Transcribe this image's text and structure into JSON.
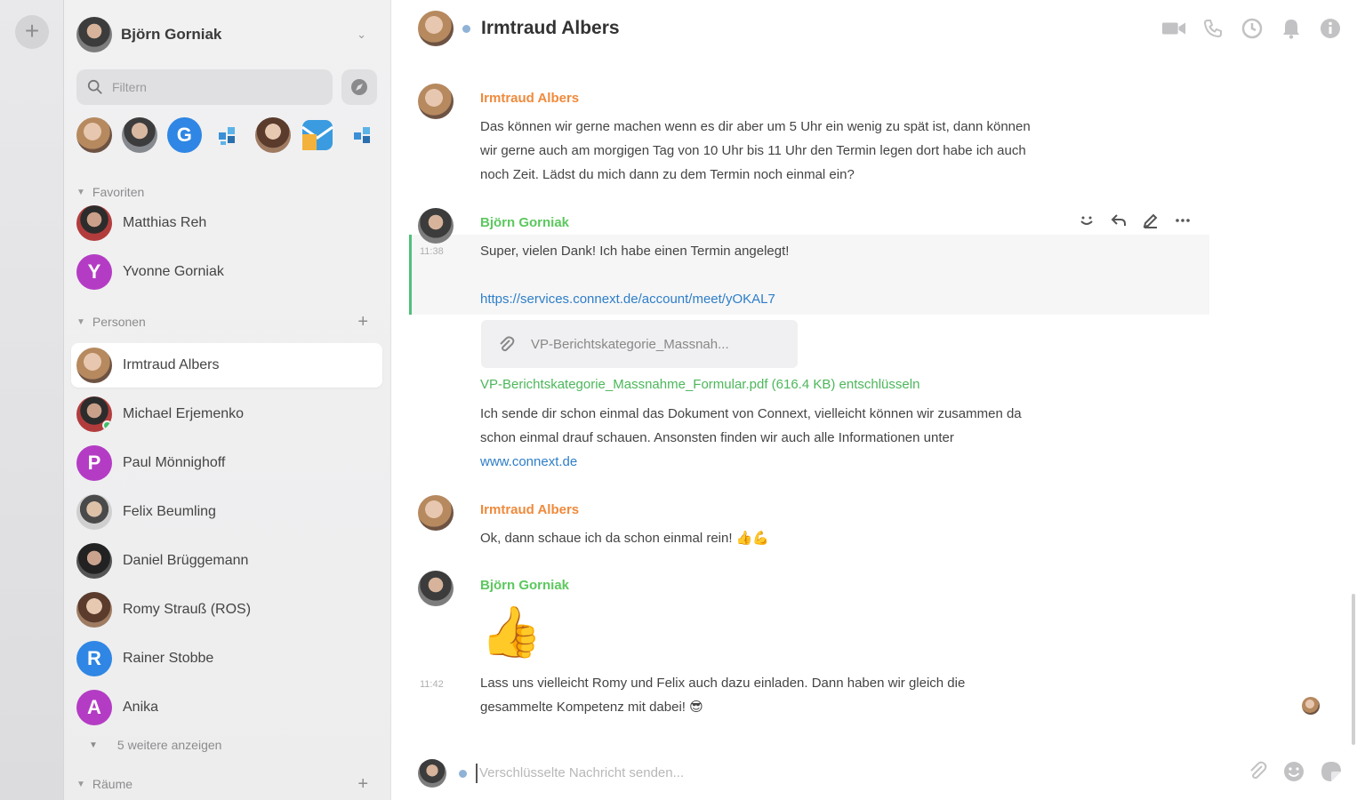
{
  "rail": {
    "add_label": "+"
  },
  "account": {
    "name": "Björn Gorniak"
  },
  "filter": {
    "placeholder": "Filtern"
  },
  "quick_contacts": [
    {
      "type": "photo"
    },
    {
      "type": "photo"
    },
    {
      "type": "letter",
      "letter": "G",
      "color": "#2f86e4"
    },
    {
      "type": "app"
    },
    {
      "type": "photo"
    },
    {
      "type": "app"
    },
    {
      "type": "app"
    }
  ],
  "sections": {
    "favorites": "Favoriten",
    "persons": "Personen",
    "rooms": "Räume"
  },
  "favorites": [
    {
      "name": "Matthias Reh"
    },
    {
      "name": "Yvonne Gorniak",
      "letter": "Y",
      "color": "#b43cc4"
    }
  ],
  "persons": [
    {
      "name": "Irmtraud Albers"
    },
    {
      "name": "Michael Erjemenko"
    },
    {
      "name": "Paul Mönnighoff",
      "letter": "P",
      "color": "#b43cc4"
    },
    {
      "name": "Felix Beumling"
    },
    {
      "name": "Daniel Brüggemann"
    },
    {
      "name": "Romy Strauß (ROS)"
    },
    {
      "name": "Rainer Stobbe",
      "letter": "R",
      "color": "#2f86e4"
    },
    {
      "name": "Anika",
      "letter": "A",
      "color": "#b43cc4"
    }
  ],
  "more_label": "5 weitere anzeigen",
  "chat": {
    "title": "Irmtraud Albers",
    "messages": [
      {
        "author": "Irmtraud Albers",
        "lines": [
          "Das können wir gerne machen wenn es dir aber um 5 Uhr ein wenig zu spät ist, dann können",
          "wir gerne auch am morgigen Tag von 10 Uhr bis 11 Uhr den Termin legen dort habe ich auch",
          "noch Zeit. Lädst du mich dann zu dem Termin noch einmal ein?"
        ]
      },
      {
        "author": "Björn Gorniak",
        "time": "11:38",
        "text": "Super, vielen Dank! Ich habe einen Termin angelegt!",
        "link": "https://services.connext.de/account/meet/yOKAL7",
        "attachment_name": "VP-Berichtskategorie_Massnah...",
        "attachment_full": "VP-Berichtskategorie_Massnahme_Formular.pdf (616.4 KB) entschlüsseln",
        "lines2": [
          "Ich sende dir schon einmal das Dokument von Connext, vielleicht können wir zusammen da",
          "schon einmal drauf schauen. Ansonsten finden wir auch alle Informationen unter"
        ],
        "link2": "www.connext.de"
      },
      {
        "author": "Irmtraud Albers",
        "text": "Ok, dann schaue ich da schon einmal rein! 👍💪"
      },
      {
        "author": "Björn Gorniak",
        "emoji": "👍",
        "time": "11:42",
        "lines": [
          "Lass uns vielleicht Romy und Felix auch dazu einladen. Dann haben wir gleich die",
          "gesammelte Kompetenz mit dabei! 😎"
        ]
      }
    ],
    "composer_placeholder": "Verschlüsselte Nachricht senden..."
  },
  "colors": {
    "accent_green": "#5cc85e",
    "accent_orange": "#f08a3c",
    "link_blue": "#2e7ec7"
  }
}
